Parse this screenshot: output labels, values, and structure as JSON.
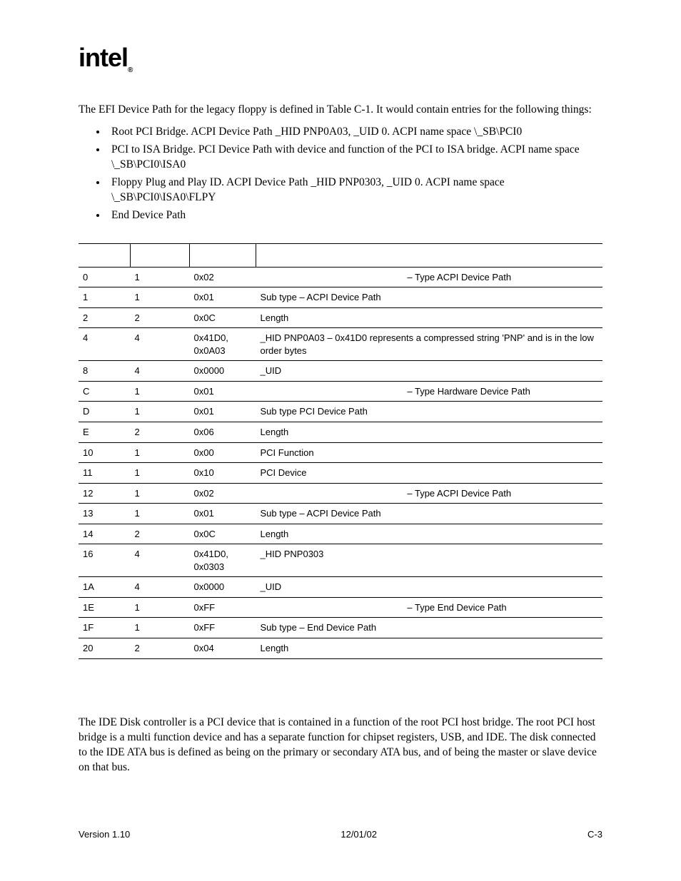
{
  "logo": "intel",
  "intro": "The EFI Device Path for the legacy floppy is defined in Table C-1.  It would contain entries for the following things:",
  "bullets": [
    "Root PCI Bridge.  ACPI Device Path _HID PNP0A03, _UID 0.  ACPI name space \\_SB\\PCI0",
    "PCI to ISA Bridge.  PCI Device Path with device and function of the PCI to ISA bridge.  ACPI name space \\_SB\\PCI0\\ISA0",
    "Floppy Plug and Play ID.  ACPI Device Path _HID PNP0303, _UID 0.  ACPI name space \\_SB\\PCI0\\ISA0\\FLPY",
    "End Device Path"
  ],
  "table": {
    "headers": [
      "",
      "",
      "",
      ""
    ],
    "rows": [
      {
        "c0": "0",
        "c1": "1",
        "c2": "0x02",
        "c3": "                                                         – Type ACPI Device Path"
      },
      {
        "c0": "1",
        "c1": "1",
        "c2": "0x01",
        "c3": "Sub type – ACPI Device Path"
      },
      {
        "c0": "2",
        "c1": "2",
        "c2": "0x0C",
        "c3": "Length"
      },
      {
        "c0": "4",
        "c1": "4",
        "c2": "0x41D0, 0x0A03",
        "c3": "_HID PNP0A03 – 0x41D0 represents a compressed string 'PNP' and is in the low order bytes"
      },
      {
        "c0": "8",
        "c1": "4",
        "c2": "0x0000",
        "c3": "_UID"
      },
      {
        "c0": "C",
        "c1": "1",
        "c2": "0x01",
        "c3": "                                                         – Type Hardware Device Path"
      },
      {
        "c0": "D",
        "c1": "1",
        "c2": "0x01",
        "c3": "Sub type PCI Device Path"
      },
      {
        "c0": "E",
        "c1": "2",
        "c2": "0x06",
        "c3": "Length"
      },
      {
        "c0": "10",
        "c1": "1",
        "c2": "0x00",
        "c3": "PCI Function"
      },
      {
        "c0": "11",
        "c1": "1",
        "c2": "0x10",
        "c3": "PCI Device"
      },
      {
        "c0": "12",
        "c1": "1",
        "c2": "0x02",
        "c3": "                                                         – Type ACPI Device Path"
      },
      {
        "c0": "13",
        "c1": "1",
        "c2": "0x01",
        "c3": "Sub type – ACPI Device Path"
      },
      {
        "c0": "14",
        "c1": "2",
        "c2": "0x0C",
        "c3": "Length"
      },
      {
        "c0": "16",
        "c1": "4",
        "c2": "0x41D0, 0x0303",
        "c3": "_HID PNP0303"
      },
      {
        "c0": "1A",
        "c1": "4",
        "c2": "0x0000",
        "c3": "_UID"
      },
      {
        "c0": "1E",
        "c1": "1",
        "c2": "0xFF",
        "c3": "                                                         – Type End Device Path"
      },
      {
        "c0": "1F",
        "c1": "1",
        "c2": "0xFF",
        "c3": "Sub type – End Device Path"
      },
      {
        "c0": "20",
        "c1": "2",
        "c2": "0x04",
        "c3": "Length"
      }
    ]
  },
  "para2": "The IDE Disk controller is a PCI device that is contained in a function of the root PCI host bridge.  The root PCI host bridge is a multi function device and has a separate function for chipset registers, USB, and IDE.  The disk connected to the IDE ATA bus is defined as being on the primary or secondary ATA bus, and of being the master or slave device on that bus.",
  "footer": {
    "left": "Version 1.10",
    "center": "12/01/02",
    "right": "C-3"
  }
}
